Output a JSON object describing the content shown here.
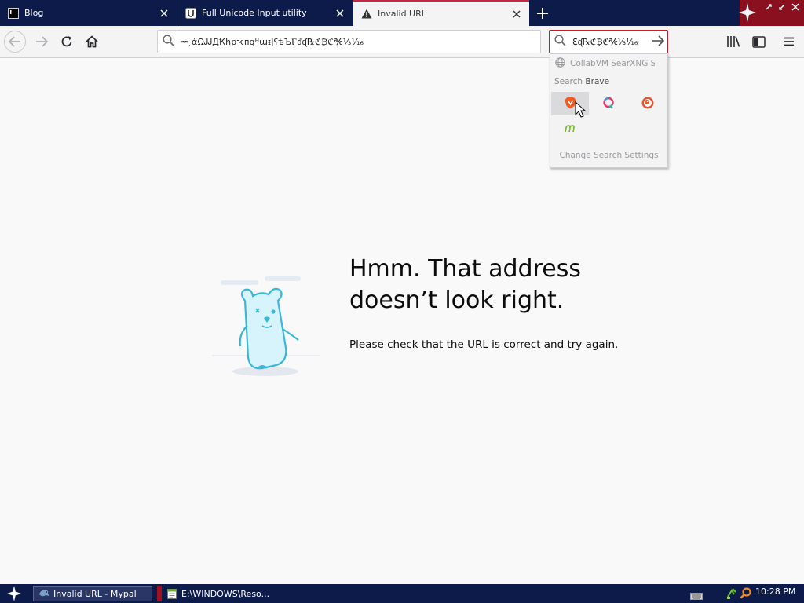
{
  "tabs": [
    {
      "label": "Blog",
      "icon": "terminal-icon",
      "active": false
    },
    {
      "label": "Full Unicode Input utility",
      "icon": "unicode-u-icon",
      "active": false
    },
    {
      "label": "Invalid URL",
      "icon": "warning-icon",
      "active": true
    }
  ],
  "urlbar": {
    "value": "ᆓ ̧ἀΩᎫᎫДҞhᵽҡᴨqᵸɯᵻɭʕѣЪⲄᵭᶑ℞ℭ₿ℭ℀⅓⅟₁₆"
  },
  "searchbar": {
    "value": "ℇᶑ℞ℭ₿ℭ℀⅓⅟₁₆"
  },
  "search_dropdown": {
    "suggestion": "CollabVM SearXNG S...",
    "search_with_prefix": "Search",
    "search_with_engine": "Brave",
    "engines": [
      "brave-icon",
      "qwant-icon",
      "duckduckgo-icon",
      "mojeek-icon"
    ],
    "change_settings": "Change Search Settings"
  },
  "error": {
    "title_line1": "Hmm. That address",
    "title_line2": "doesn’t look right.",
    "description": "Please check that the URL is correct and try again."
  },
  "taskbar": {
    "tasks": [
      "Invalid URL - Mypal",
      "E:\\WINDOWS\\Reso..."
    ],
    "clock": "10:28 PM"
  },
  "colors": {
    "titlebar": "#0c1b4a",
    "accent_red": "#c8283c",
    "page_bg": "#f9f9fa"
  }
}
